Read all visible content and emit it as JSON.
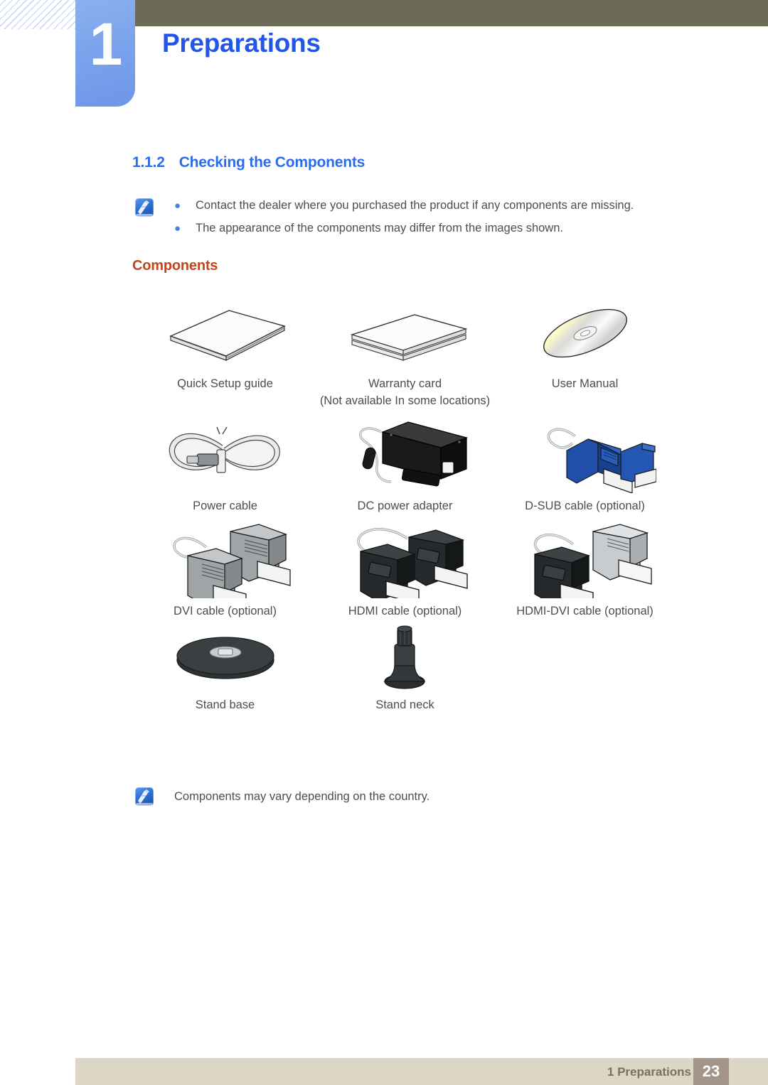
{
  "header": {
    "chapter_number": "1",
    "chapter_title": "Preparations",
    "accent_blue": "#2355e8",
    "olive": "#6c6b55"
  },
  "section": {
    "number": "1.1.2",
    "title": "Checking the Components",
    "color": "#2a6ceb"
  },
  "top_note": {
    "icon": "note-icon",
    "bullets": [
      "Contact the dealer where you purchased the product if any components are missing.",
      "The appearance of the components may differ from the images shown."
    ]
  },
  "sub_heading": {
    "label": "Components",
    "color": "#c4451b"
  },
  "components": [
    [
      {
        "icon": "booklet-icon",
        "label": "Quick Setup guide",
        "label2": ""
      },
      {
        "icon": "warranty-card-icon",
        "label": "Warranty card",
        "label2": "(Not available In some locations)"
      },
      {
        "icon": "cd-disc-icon",
        "label": "User Manual",
        "label2": ""
      }
    ],
    [
      {
        "icon": "power-cable-icon",
        "label": "Power cable",
        "label2": ""
      },
      {
        "icon": "dc-power-adapter-icon",
        "label": "DC power adapter",
        "label2": ""
      },
      {
        "icon": "d-sub-cable-icon",
        "label": "D-SUB cable (optional)",
        "label2": ""
      }
    ],
    [
      {
        "icon": "dvi-cable-icon",
        "label": "DVI cable (optional)",
        "label2": ""
      },
      {
        "icon": "hdmi-cable-icon",
        "label": "HDMI cable (optional)",
        "label2": ""
      },
      {
        "icon": "hdmi-dvi-cable-icon",
        "label": "HDMI-DVI cable (optional)",
        "label2": ""
      }
    ],
    [
      {
        "icon": "stand-base-icon",
        "label": "Stand base",
        "label2": ""
      },
      {
        "icon": "stand-neck-icon",
        "label": "Stand neck",
        "label2": ""
      },
      {
        "icon": "",
        "label": "",
        "label2": ""
      }
    ]
  ],
  "bottom_note": {
    "icon": "note-icon",
    "text": "Components may vary depending on the country."
  },
  "footer": {
    "label": "1 Preparations",
    "page_number": "23",
    "bar_color": "#dcd7c4",
    "page_box_color": "#a3958a"
  }
}
